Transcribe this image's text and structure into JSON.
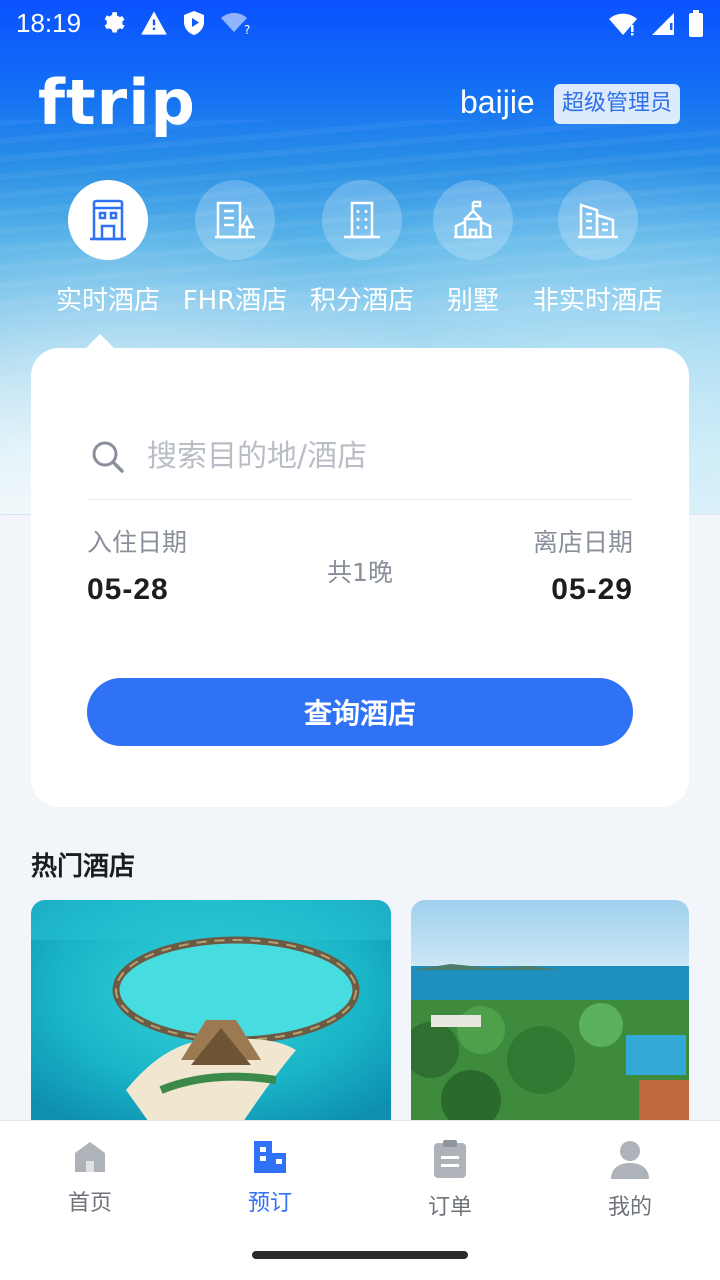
{
  "status_bar": {
    "time": "18:19",
    "icons_left": [
      "gear-icon",
      "warning-icon",
      "shield-icon",
      "wifi-question-icon"
    ],
    "icons_right": [
      "wifi-icon",
      "signal-icon",
      "battery-icon"
    ]
  },
  "header": {
    "logo": "ftrip",
    "username": "baijie",
    "role": "超级管理员"
  },
  "categories": [
    {
      "label": "实时酒店",
      "icon": "hotel-building-icon",
      "active": true
    },
    {
      "label": "FHR酒店",
      "icon": "hotel-tree-icon",
      "active": false
    },
    {
      "label": "积分酒店",
      "icon": "office-building-icon",
      "active": false
    },
    {
      "label": "别墅",
      "icon": "villa-icon",
      "active": false
    },
    {
      "label": "非实时酒店",
      "icon": "city-building-icon",
      "active": false
    }
  ],
  "search": {
    "placeholder": "搜索目的地/酒店",
    "checkin_label": "入住日期",
    "checkin_date": "05-28",
    "checkout_label": "离店日期",
    "checkout_date": "05-29",
    "nights": "共1晚",
    "button_label": "查询酒店"
  },
  "hot_hotels": {
    "title": "热门酒店"
  },
  "tabbar": {
    "items": [
      {
        "label": "首页",
        "icon": "home-icon",
        "active": false
      },
      {
        "label": "预订",
        "icon": "booking-building-icon",
        "active": true
      },
      {
        "label": "订单",
        "icon": "clipboard-icon",
        "active": false
      },
      {
        "label": "我的",
        "icon": "user-icon",
        "active": false
      }
    ]
  },
  "colors": {
    "accent": "#2f72f6",
    "hero_top": "#0a52ff",
    "text_primary": "#1b1d21",
    "text_secondary": "#8a9099"
  }
}
